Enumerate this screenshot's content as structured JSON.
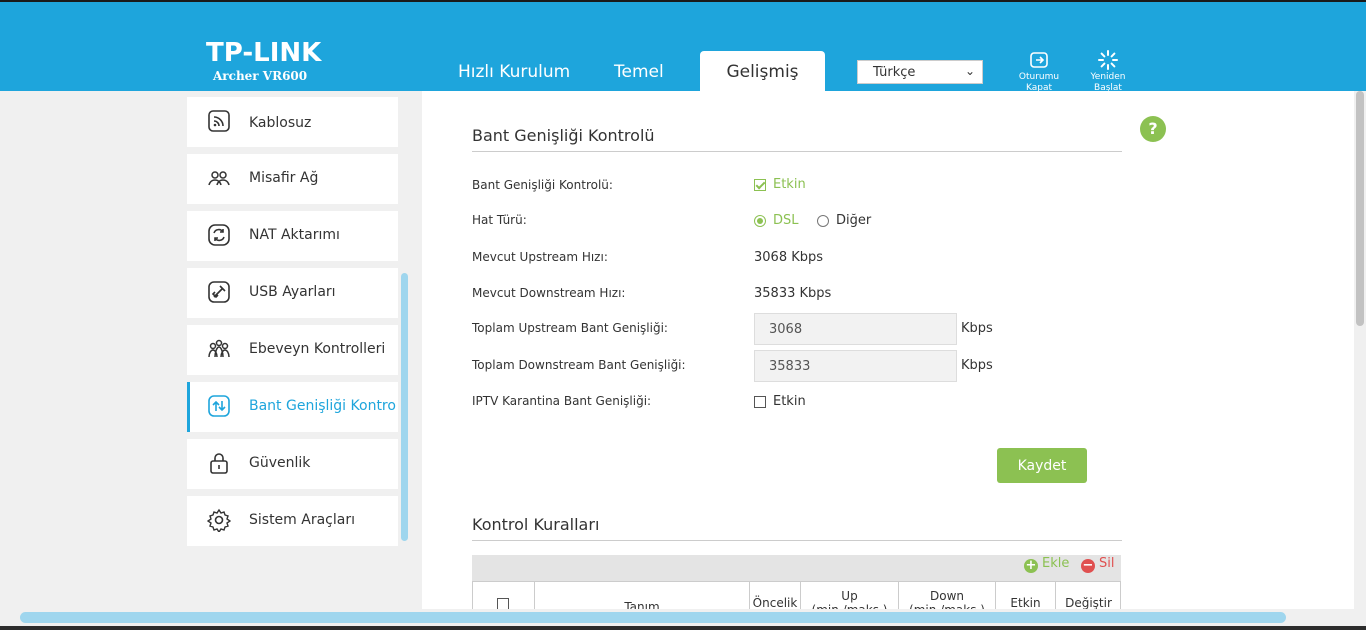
{
  "header": {
    "brand": "TP-LINK",
    "model": "Archer VR600",
    "tabs": [
      {
        "label": "Hızlı Kurulum",
        "active": false
      },
      {
        "label": "Temel",
        "active": false
      },
      {
        "label": "Gelişmiş",
        "active": true
      }
    ],
    "language": {
      "selected": "Türkçe"
    },
    "logout": {
      "label": "Oturumu Kapat",
      "icon": "logout-icon"
    },
    "reboot": {
      "label": "Yeniden Başlat",
      "icon": "reboot-icon"
    },
    "accent_color": "#1ea5dc"
  },
  "sidebar": {
    "items": [
      {
        "label": "Kablosuz",
        "icon": "wireless-icon",
        "active": false
      },
      {
        "label": "Misafir Ağ",
        "icon": "guest-network-icon",
        "active": false
      },
      {
        "label": "NAT Aktarımı",
        "icon": "nat-forwarding-icon",
        "active": false
      },
      {
        "label": "USB Ayarları",
        "icon": "usb-icon",
        "active": false
      },
      {
        "label": "Ebeveyn Kontrolleri",
        "icon": "parental-controls-icon",
        "active": false
      },
      {
        "label": "Bant Genişliği Kontrolü",
        "icon": "bandwidth-icon",
        "active": true
      },
      {
        "label": "Güvenlik",
        "icon": "lock-icon",
        "active": false
      },
      {
        "label": "Sistem Araçları",
        "icon": "gear-icon",
        "active": false
      }
    ]
  },
  "bandwidth": {
    "title": "Bant Genişliği Kontrolü",
    "enable_label": "Bant Genişliği Kontrolü:",
    "enable_option": "Etkin",
    "enable_checked": true,
    "line_type_label": "Hat Türü:",
    "line_type_options": [
      "DSL",
      "Diğer"
    ],
    "line_type_selected": "DSL",
    "upstream_label": "Mevcut Upstream Hızı:",
    "upstream_value": "3068 Kbps",
    "downstream_label": "Mevcut Downstream Hızı:",
    "downstream_value": "35833 Kbps",
    "total_up_label": "Toplam Upstream Bant Genişliği:",
    "total_up_value": "3068",
    "total_down_label": "Toplam Downstream Bant Genişliği:",
    "total_down_value": "35833",
    "unit": "Kbps",
    "iptv_label": "IPTV Karantina Bant Genişliği:",
    "iptv_option": "Etkin",
    "iptv_checked": false,
    "save_label": "Kaydet",
    "help": "?"
  },
  "rules": {
    "title": "Kontrol Kuralları",
    "add_label": "Ekle",
    "delete_label": "Sil",
    "columns": [
      "Tanım",
      "Öncelik",
      "Up (min./maks.)",
      "Down (min./maks.)",
      "Etkin",
      "Değiştir"
    ]
  }
}
